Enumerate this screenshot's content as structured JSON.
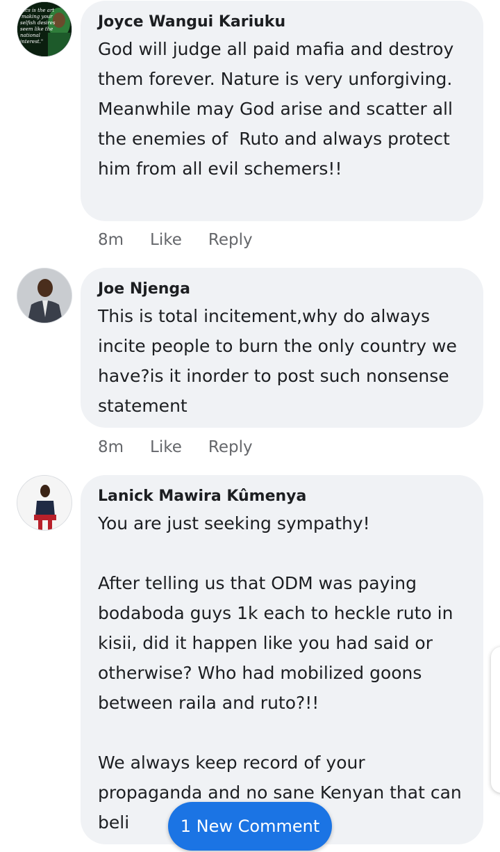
{
  "comments": [
    {
      "author": "Joyce Wangui Kariuku",
      "text": "God will judge all paid mafia and destroy them forever. Nature is very unforgiving. Meanwhile may God arise and scatter all the enemies of  Ruto and always protect him from all evil schemers!!",
      "time": "8m",
      "like": "Like",
      "reply": "Reply",
      "avatar_lines": [
        "itics is the art",
        "making your",
        "selfish desires",
        "seem like the",
        "national",
        "interest.\""
      ]
    },
    {
      "author": "Joe Njenga",
      "text": "This is total incitement,why do always incite people to burn the only country we have?is it inorder to post such nonsense statement",
      "time": "8m",
      "like": "Like",
      "reply": "Reply"
    },
    {
      "author": "Lanick Mawira Kûmenya",
      "text": "You are just seeking sympathy!\n\nAfter telling us that ODM was paying bodaboda guys 1k each to heckle ruto in kisii, did it happen like you had said or otherwise? Who had mobilized goons between raila and ruto?!!\n\nWe always keep record of your propaganda and no sane Kenyan that can beli",
      "time": "",
      "like": "",
      "reply": ""
    }
  ],
  "new_comment_label": "1 New Comment",
  "colors": {
    "bubble": "#f0f2f5",
    "meta": "#65676b",
    "accent": "#1b74e4"
  }
}
